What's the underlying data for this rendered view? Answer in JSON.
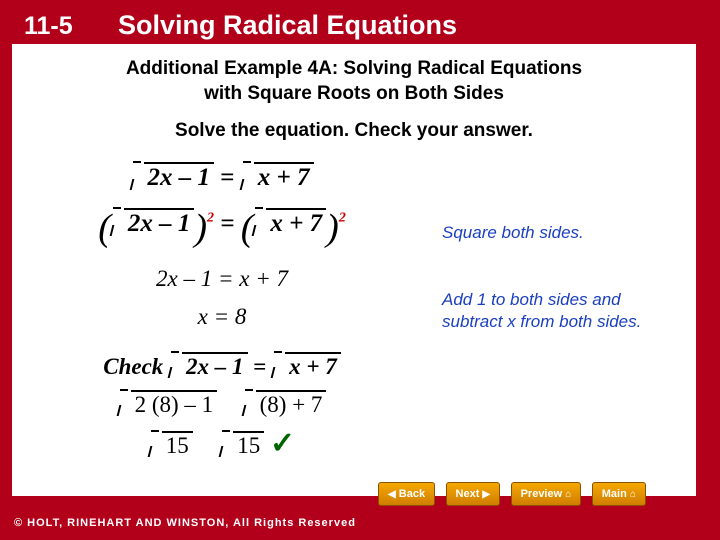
{
  "header": {
    "lesson_number": "11-5",
    "lesson_title": "Solving Radical Equations"
  },
  "slide": {
    "example_heading_line1": "Additional Example 4A: Solving Radical Equations",
    "example_heading_line2": "with Square Roots on Both Sides",
    "instruction": "Solve the equation. Check your answer.",
    "math": {
      "eq1_left": "2x – 1",
      "eq1_eq": "=",
      "eq1_right": "x + 7",
      "eq2_left": "2x – 1",
      "eq2_right": "x + 7",
      "eq2_exp": "2",
      "eq3": "2x – 1 = x + 7",
      "eq4": "x  =  8",
      "check_label": "Check",
      "check_left": "2x – 1",
      "check_eq": "=",
      "check_right": "x + 7",
      "sub_left": "2 (8) – 1",
      "sub_right": "(8) + 7",
      "result_left": "15",
      "result_right": "15",
      "tick": "✓"
    },
    "notes": {
      "note1": "Square both sides.",
      "note2": "Add 1 to both sides and subtract x from both sides."
    }
  },
  "nav": {
    "back": "Back",
    "next": "Next",
    "preview": "Preview",
    "main": "Main",
    "back_icon": "◀",
    "next_icon": "▶",
    "preview_icon": "⌂",
    "main_icon": "⌂"
  },
  "footer": {
    "copyright": "© HOLT, RINEHART AND WINSTON, All Rights Reserved"
  },
  "colors": {
    "background": "#b2001a",
    "slide": "#ffffff",
    "note": "#1a3fbf",
    "exponent": "#cc0000",
    "check": "#006400"
  }
}
